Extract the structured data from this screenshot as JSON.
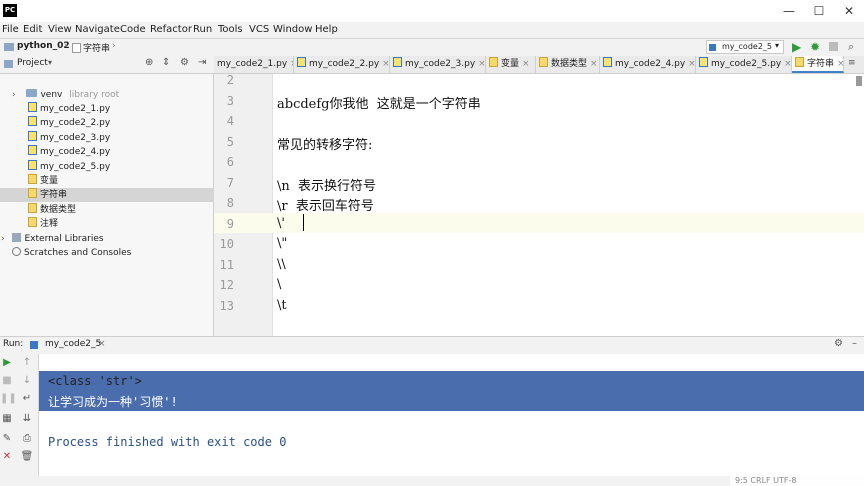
{
  "app": {
    "logo_text": "PC",
    "window_controls": [
      "—",
      "☐",
      "✕"
    ]
  },
  "menu": [
    "File",
    "Edit",
    "View",
    "Navigate",
    "Code",
    "Refactor",
    "Run",
    "Tools",
    "VCS",
    "Window",
    "Help"
  ],
  "breadcrumb": {
    "project": "python_02",
    "file": "字符串"
  },
  "run_config": {
    "name": "my_code2_5"
  },
  "project_panel": {
    "title": "Project",
    "items": [
      {
        "label": "venv",
        "suffix": "library root",
        "type": "folder"
      },
      {
        "label": "my_code2_1.py",
        "type": "py"
      },
      {
        "label": "my_code2_2.py",
        "type": "py"
      },
      {
        "label": "my_code2_3.py",
        "type": "py"
      },
      {
        "label": "my_code2_4.py",
        "type": "py"
      },
      {
        "label": "my_code2_5.py",
        "type": "py"
      },
      {
        "label": "变量",
        "type": "file"
      },
      {
        "label": "字符串",
        "type": "file",
        "selected": true
      },
      {
        "label": "数据类型",
        "type": "file"
      },
      {
        "label": "注释",
        "type": "file"
      },
      {
        "label": "External Libraries",
        "type": "lib"
      },
      {
        "label": "Scratches and Consoles",
        "type": "scratch"
      }
    ]
  },
  "tabs": [
    {
      "label": "my_code2_1.py"
    },
    {
      "label": "my_code2_2.py"
    },
    {
      "label": "my_code2_3.py"
    },
    {
      "label": "变量"
    },
    {
      "label": "数据类型"
    },
    {
      "label": "my_code2_4.py"
    },
    {
      "label": "my_code2_5.py"
    },
    {
      "label": "字符串",
      "active": true
    }
  ],
  "editor": {
    "line_numbers": [
      "2",
      "3",
      "4",
      "5",
      "6",
      "7",
      "8",
      "9",
      "10",
      "11",
      "12",
      "13"
    ],
    "lines": [
      "",
      "abcdefg你我他  这就是一个字符串",
      "",
      "常见的转移字符:",
      "",
      "\\n  表示换行符号",
      "\\r  表示回车符号",
      "\\'",
      "\\\"",
      "\\\\",
      "\\",
      "\\t"
    ]
  },
  "run_panel": {
    "label": "Run:",
    "config": "my_code2_5",
    "console_lines": [
      "<class 'str'>",
      "让学习成为一种'习惯'!",
      "",
      "Process finished with exit code 0"
    ]
  },
  "status": {
    "text": "9:5  CRLF  UTF-8"
  }
}
